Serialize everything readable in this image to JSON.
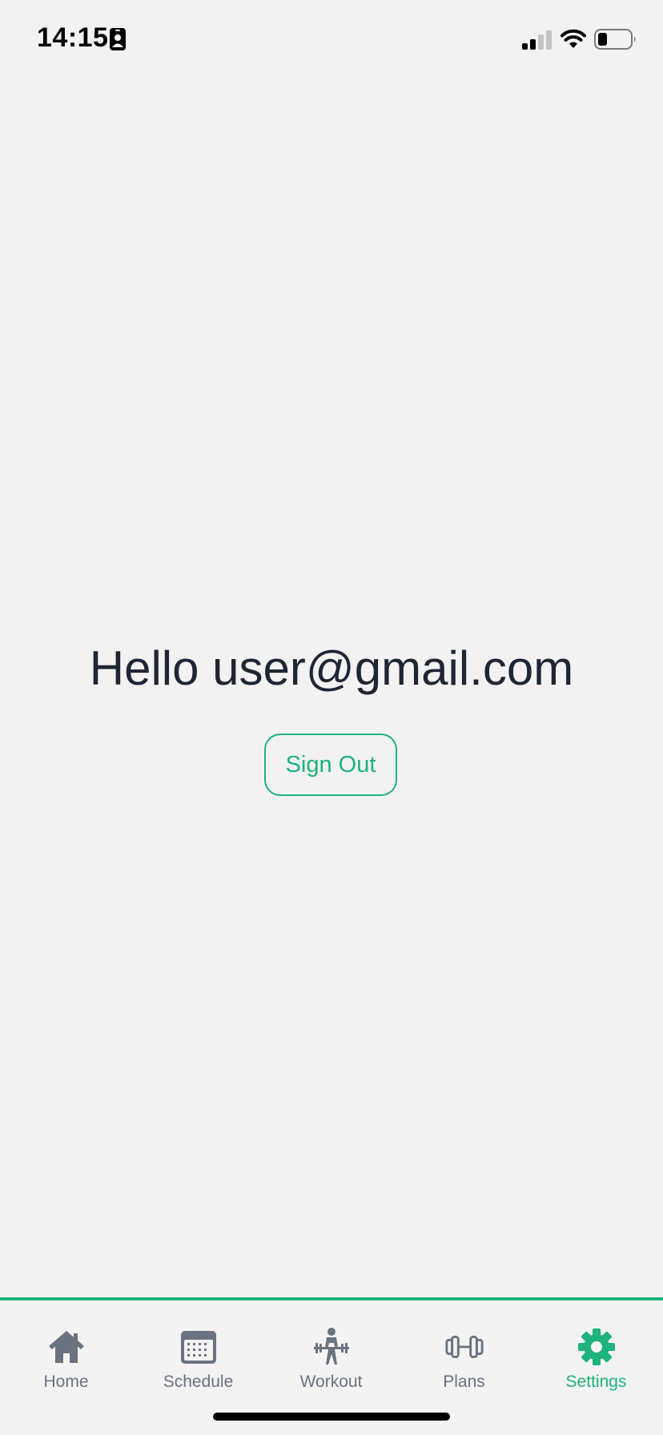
{
  "status_bar": {
    "time": "14:15",
    "icons": [
      "id-badge-icon",
      "cellular-signal-icon",
      "wifi-icon",
      "battery-icon"
    ]
  },
  "main": {
    "greeting": "Hello user@gmail.com",
    "sign_out_label": "Sign Out"
  },
  "tab_bar": {
    "tabs": [
      {
        "label": "Home",
        "icon": "home-icon",
        "active": false
      },
      {
        "label": "Schedule",
        "icon": "calendar-icon",
        "active": false
      },
      {
        "label": "Workout",
        "icon": "weightlifter-icon",
        "active": false
      },
      {
        "label": "Plans",
        "icon": "dumbbell-icon",
        "active": false
      },
      {
        "label": "Settings",
        "icon": "gear-icon",
        "active": true
      }
    ]
  },
  "colors": {
    "accent": "#1db37a",
    "text_primary": "#1e2634",
    "tab_inactive": "#6b7280",
    "background": "#f2f2f2"
  }
}
